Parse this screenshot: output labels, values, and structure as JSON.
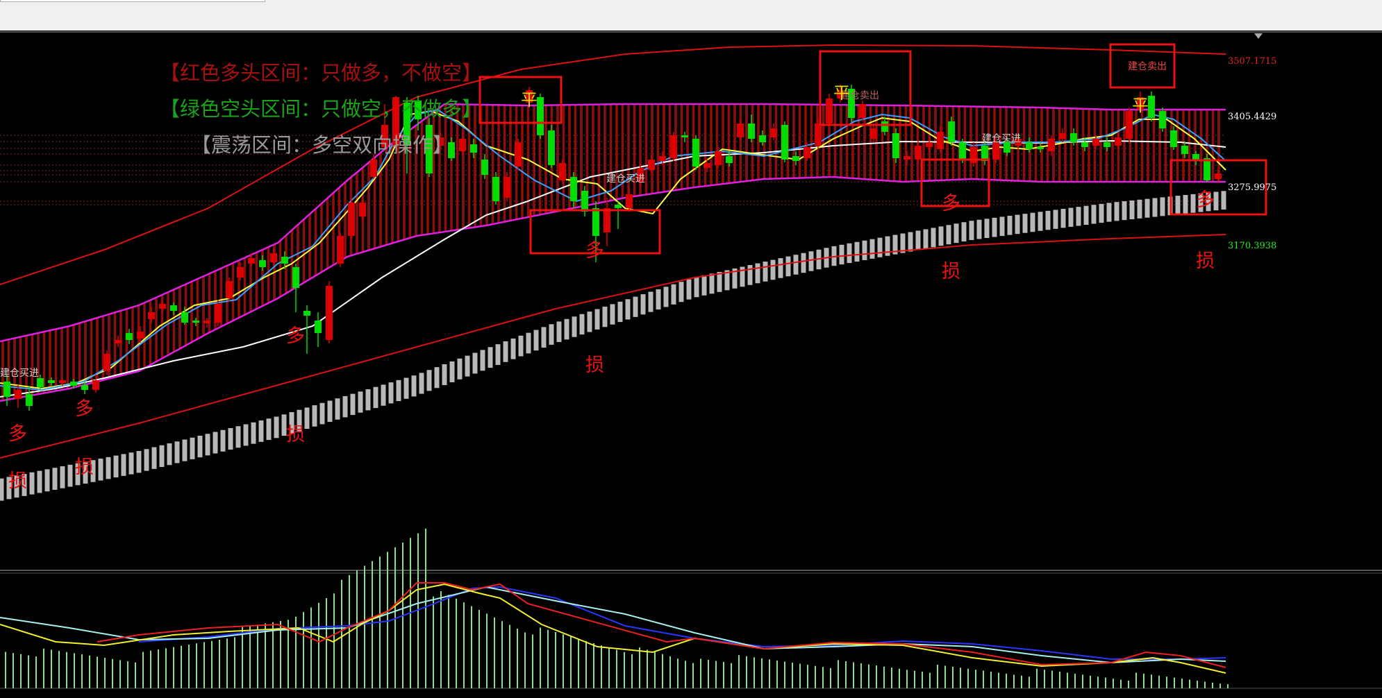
{
  "chart_data": [
    {
      "type": "candlestick",
      "legend": {
        "red_zone": "【红色多头区间：只做多，不做空】",
        "green_zone": "【绿色空头区间：只做空，不做多】",
        "range_zone": "【震荡区间：多空双向操作】"
      },
      "price_labels": [
        "3507.1715",
        "3405.4429",
        "3275.9975",
        "3170.3938"
      ],
      "annotations": {
        "long": "多",
        "stop_loss": "损",
        "open_buy": "建仓买进",
        "open_sell": "建仓卖出",
        "flat": "平"
      },
      "colors": {
        "up_candle": "#dd0000",
        "down_candle": "#00dd00",
        "channel": "#e020e0",
        "band": "#dd1111",
        "ma_fast": "#3aa0ff",
        "ma_mid": "#ffff40",
        "ma_slow": "#ffffff",
        "stop_ribbon": "#b8b8b8"
      }
    },
    {
      "type": "histogram-with-lines",
      "panel": "indicator"
    }
  ]
}
